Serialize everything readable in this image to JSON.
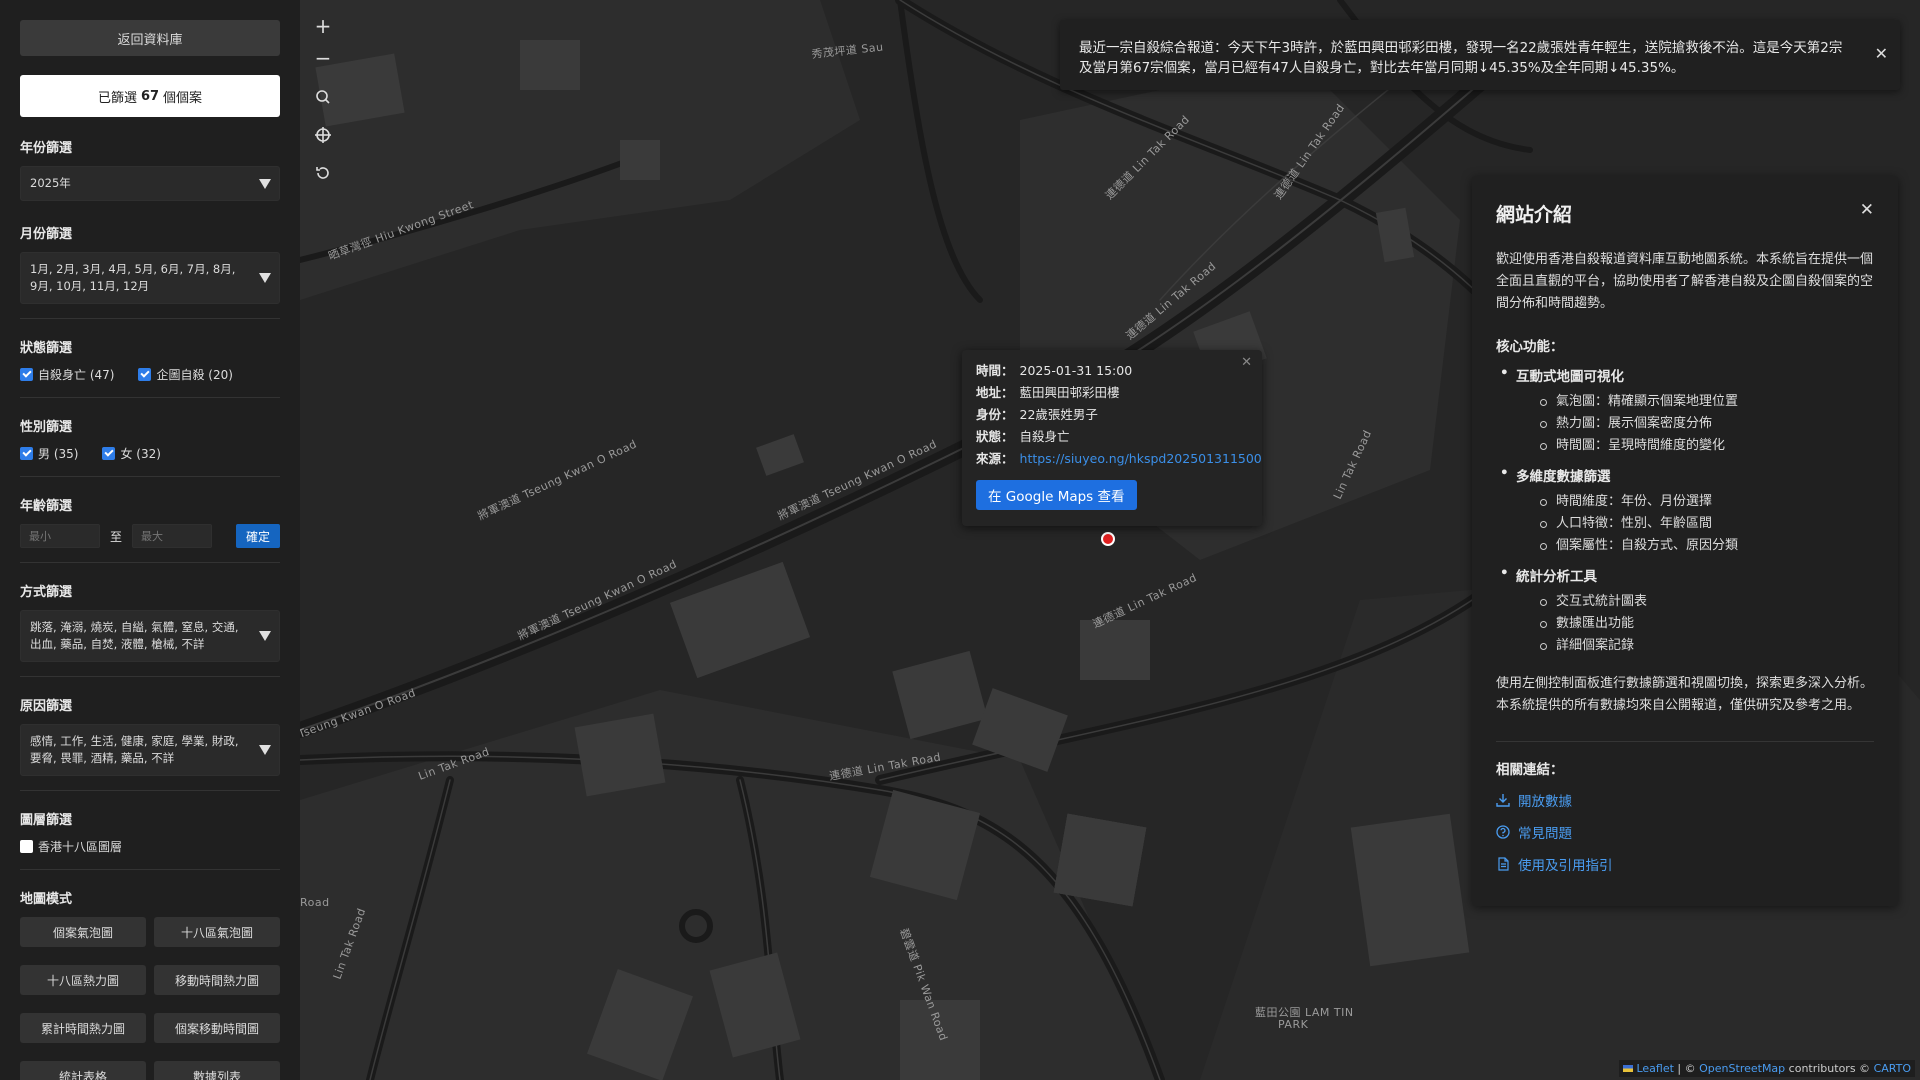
{
  "sidebar": {
    "back_label": "返回資料庫",
    "filtered": {
      "prefix": "已篩選",
      "count": "67",
      "suffix": "個個案"
    },
    "year": {
      "title": "年份篩選",
      "value": "2025年"
    },
    "month": {
      "title": "月份篩選",
      "value": "1月, 2月, 3月, 4月, 5月, 6月, 7月, 8月, 9月, 10月, 11月, 12月"
    },
    "status": {
      "title": "狀態篩選",
      "options": [
        {
          "label": "自殺身亡 (47)",
          "checked": true
        },
        {
          "label": "企圖自殺 (20)",
          "checked": true
        }
      ]
    },
    "gender": {
      "title": "性別篩選",
      "options": [
        {
          "label": "男 (35)",
          "checked": true
        },
        {
          "label": "女 (32)",
          "checked": true
        }
      ]
    },
    "age": {
      "title": "年齡篩選",
      "min_placeholder": "最小",
      "to": "至",
      "max_placeholder": "最大",
      "confirm": "確定"
    },
    "method": {
      "title": "方式篩選",
      "value": "跳落, 淹溺, 燒炭, 自縊, 氣體, 窒息, 交通, 出血, 藥品, 自焚, 液體, 槍械, 不詳"
    },
    "reason": {
      "title": "原因篩選",
      "value": "感情, 工作, 生活, 健康, 家庭, 學業, 財政, 要脅, 畏罪, 酒精, 藥品, 不詳"
    },
    "layer": {
      "title": "圖層篩選",
      "option": "香港十八區圖層",
      "checked": false
    },
    "map_mode": {
      "title": "地圖模式",
      "buttons": [
        "個案氣泡圖",
        "十八區氣泡圖",
        "十八區熱力圖",
        "移動時間熱力圖",
        "累計時間熱力圖",
        "個案移動時間圖",
        "統計表格",
        "數據列表"
      ]
    }
  },
  "map": {
    "controls": {
      "zoom_in": "+",
      "zoom_out": "−"
    },
    "road_labels": [
      "秀茂坪道 Sau",
      "晒草灣徑 Hiu Kwong Street",
      "將軍澳道 Tseung Kwan O Road",
      "將軍澳道 Tseung Kwan O Road",
      "Tseung Kwan O Road",
      "連德道 Lin Tak Road",
      "連德道 Lin Tak Road",
      "連德道 Lin Tak Road",
      "Lin Tak Road",
      "連德道 Lin Tak Road",
      "碧雲道 Pik Wan Road",
      "Lin Tak Road",
      "將軍澳道 Tseung Kwan O Road",
      "連德道 Lin Tak Road",
      "Road",
      "Lin Tak Road"
    ],
    "park_label": {
      "zh": "藍田公園 LAM TIN",
      "en": "PARK"
    },
    "news": {
      "text": "最近一宗自殺綜合報道：今天下午3時許，於藍田興田邨彩田樓，發現一名22歲張姓青年輕生，送院搶救後不治。這是今天第2宗及當月第67宗個案，當月已經有47人自殺身亡，對比去年當月同期↓45.35%及全年同期↓45.35%。",
      "close": "✕"
    },
    "popup": {
      "close": "✕",
      "rows": [
        {
          "k": "時間：",
          "v": "2025-01-31 15:00"
        },
        {
          "k": "地址：",
          "v": "藍田興田邨彩田樓"
        },
        {
          "k": "身份：",
          "v": "22歲張姓男子"
        },
        {
          "k": "狀態：",
          "v": "自殺身亡"
        }
      ],
      "source_label": "來源：",
      "source_link": "https://siuyeo.ng/hkspd202501311500",
      "gmaps_button": "在 Google Maps 查看"
    },
    "intro": {
      "title": "網站介紹",
      "close": "✕",
      "intro_text": "歡迎使用香港自殺報道資料庫互動地圖系統。本系統旨在提供一個全面且直觀的平台，協助使用者了解香港自殺及企圖自殺個案的空間分佈和時間趨勢。",
      "core_title": "核心功能：",
      "features": [
        {
          "title": "互動式地圖可視化",
          "items": [
            "氣泡圖：精確顯示個案地理位置",
            "熱力圖：展示個案密度分佈",
            "時間圖：呈現時間維度的變化"
          ]
        },
        {
          "title": "多維度數據篩選",
          "items": [
            "時間維度：年份、月份選擇",
            "人口特徵：性別、年齡區間",
            "個案屬性：自殺方式、原因分類"
          ]
        },
        {
          "title": "統計分析工具",
          "items": [
            "交互式統計圖表",
            "數據匯出功能",
            "詳細個案記錄"
          ]
        }
      ],
      "usage_text": "使用左側控制面板進行數據篩選和視圖切換，探索更多深入分析。本系統提供的所有數據均來自公開報道，僅供研究及參考之用。",
      "links_title": "相關連結：",
      "links": [
        "開放數據",
        "常見問題",
        "使用及引用指引"
      ]
    },
    "attribution": {
      "leaflet": "Leaflet",
      "sep": " | © ",
      "osm": "OpenStreetMap",
      "mid": " contributors © ",
      "carto": "CARTO"
    }
  }
}
